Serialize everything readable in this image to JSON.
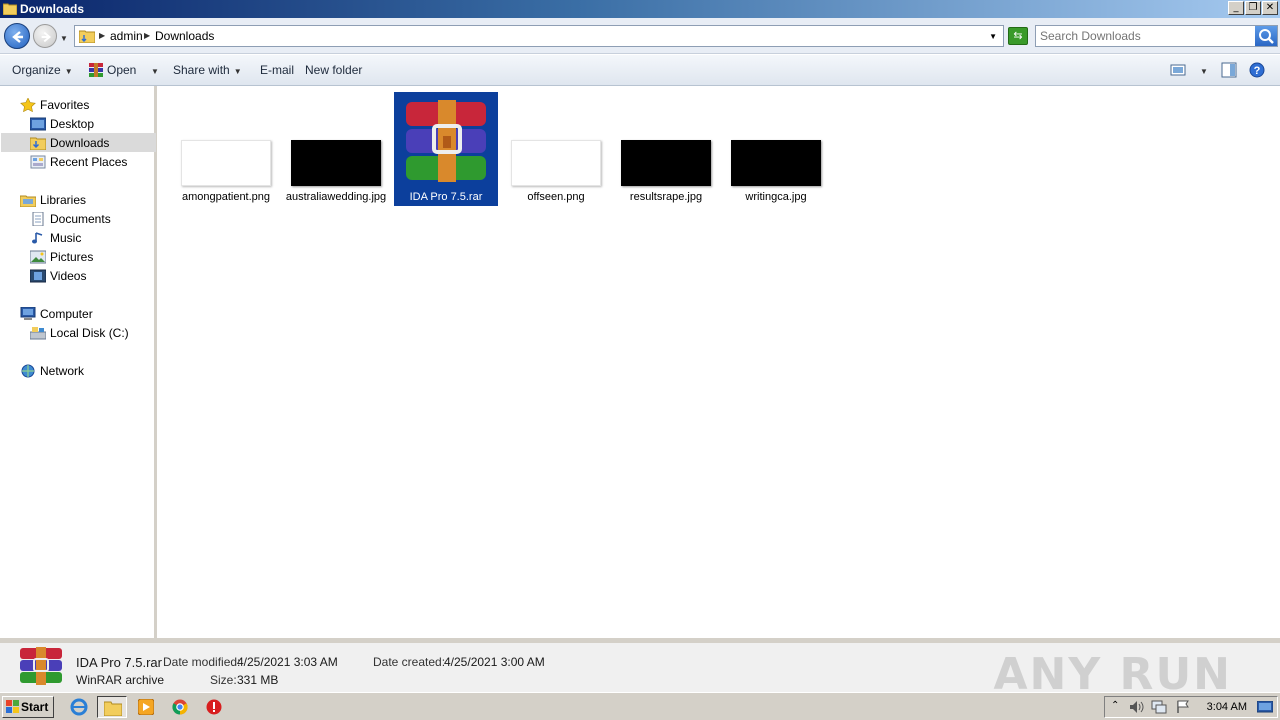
{
  "window": {
    "title": "Downloads"
  },
  "address": {
    "crumbs": [
      "admin",
      "Downloads"
    ]
  },
  "search": {
    "placeholder": "Search Downloads"
  },
  "toolbar": {
    "organize": "Organize",
    "open": "Open",
    "share_with": "Share with",
    "email": "E-mail",
    "new_folder": "New folder"
  },
  "sidebar": {
    "favorites": "Favorites",
    "desktop": "Desktop",
    "downloads": "Downloads",
    "recent_places": "Recent Places",
    "libraries": "Libraries",
    "documents": "Documents",
    "music": "Music",
    "pictures": "Pictures",
    "videos": "Videos",
    "computer": "Computer",
    "local_disk": "Local Disk (C:)",
    "network": "Network"
  },
  "files": [
    {
      "name": "amongpatient.png",
      "thumb": "white"
    },
    {
      "name": "australiawedding.jpg",
      "thumb": "black"
    },
    {
      "name": "IDA Pro 7.5.rar",
      "thumb": "winrar",
      "selected": true
    },
    {
      "name": "offseen.png",
      "thumb": "white"
    },
    {
      "name": "resultsrape.jpg",
      "thumb": "black"
    },
    {
      "name": "writingca.jpg",
      "thumb": "black"
    }
  ],
  "details": {
    "name": "IDA Pro 7.5.rar",
    "type": "WinRAR archive",
    "modified_label": "Date modified:",
    "modified": "4/25/2021 3:03 AM",
    "created_label": "Date created:",
    "created": "4/25/2021 3:00 AM",
    "size_label": "Size:",
    "size": "331 MB"
  },
  "watermark": "ANY RUN",
  "taskbar": {
    "start": "Start",
    "clock": "3:04 AM"
  },
  "colors": {
    "selection": "#0c3f9c",
    "title_gradient_start": "#0a246a"
  }
}
